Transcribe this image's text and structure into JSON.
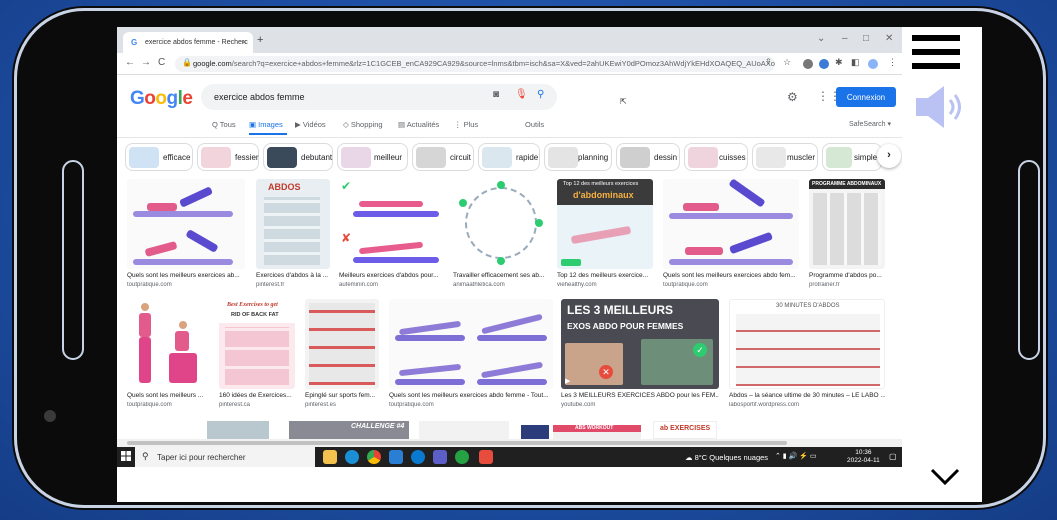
{
  "browser": {
    "tab_title": "exercice abdos femme - Recherc",
    "tab_close": "×",
    "new_tab": "+",
    "url_host": "google.com",
    "url_path": "/search?q=exercice+abdos+femme&rlz=1C1GCEB_enCA929CA929&source=lnms&tbm=isch&sa=X&ved=2ahUKEwiY0dPOmoz3AhWdjYkEHdXOAQEQ_AUoAXoECA...",
    "back": "←",
    "forward": "→",
    "reload": "C"
  },
  "google": {
    "logo": [
      "G",
      "o",
      "o",
      "g",
      "l",
      "e"
    ],
    "logo_colors": [
      "#4285f4",
      "#ea4335",
      "#fbbc05",
      "#4285f4",
      "#34a853",
      "#ea4335"
    ],
    "query": "exercice abdos femme",
    "sign_in": "Connexion",
    "tabs": [
      {
        "label": "Tous",
        "icon": "Q"
      },
      {
        "label": "Images",
        "icon": "▣"
      },
      {
        "label": "Vidéos",
        "icon": "▶"
      },
      {
        "label": "Shopping",
        "icon": "◇"
      },
      {
        "label": "Actualités",
        "icon": "▤"
      },
      {
        "label": "Plus",
        "icon": "⋮"
      }
    ],
    "outils": "Outils",
    "safesearch": "SafeSearch ▾"
  },
  "chips": [
    {
      "label": "efficace",
      "color": "#cfe3f5"
    },
    {
      "label": "fessier",
      "color": "#f2d4dc"
    },
    {
      "label": "debutant",
      "color": "#3a4a5a"
    },
    {
      "label": "meilleur",
      "color": "#e9d6e6"
    },
    {
      "label": "circuit",
      "color": "#d6d6d6"
    },
    {
      "label": "rapide",
      "color": "#dbe7ee"
    },
    {
      "label": "planning",
      "color": "#e4e4e4"
    },
    {
      "label": "dessin",
      "color": "#cfcfcf"
    },
    {
      "label": "cuisses",
      "color": "#f0d4dd"
    },
    {
      "label": "muscler",
      "color": "#e8e8e8"
    },
    {
      "label": "simple",
      "color": "#d4e8d4"
    }
  ],
  "results_row1": [
    {
      "caption": "Quels sont les meilleurs exercices ab...",
      "source": "toutpratique.com"
    },
    {
      "caption": "Exercices d'abdos à la ...",
      "source": "pinterest.fr",
      "overlay": "ABDOS"
    },
    {
      "caption": "Meilleurs exercices d'abdos pour...",
      "source": "aufeminin.com"
    },
    {
      "caption": "Travailler efficacement ses ab...",
      "source": "animaathletica.com"
    },
    {
      "caption": "Top 12 des meilleurs exercice...",
      "source": "viehealthy.com",
      "overlay_top": "Top 12 des meilleurs exercices",
      "overlay_main": "d'abdominaux"
    },
    {
      "caption": "Quels sont les meilleurs exercices abdo fem...",
      "source": "toutpratique.com"
    },
    {
      "caption": "Programme d'abdos po...",
      "source": "protrainer.fr",
      "overlay": "PROGRAMME ABDOMINAUX"
    }
  ],
  "results_row2": [
    {
      "caption": "Quels sont les meilleurs ...",
      "source": "toutpratique.com"
    },
    {
      "caption": "160 idées de Exercices...",
      "source": "pinterest.ca",
      "overlay_top": "Best Exercises to get",
      "overlay_main": "RID OF BACK FAT"
    },
    {
      "caption": "Épinglé sur sports fem...",
      "source": "pinterest.es"
    },
    {
      "caption": "Quels sont les meilleurs exercices abdo femme - Tout...",
      "source": "toutpratique.com"
    },
    {
      "caption": "Les 3 MEILLEURS EXERCICES ABDO pour les FEM...",
      "source": "youtube.com",
      "overlay_1": "LES 3 MEILLEURS",
      "overlay_2": "EXOS ABDO POUR FEMMES"
    },
    {
      "caption": "Abdos – la séance ultime de 30 minutes – LE LABO ...",
      "source": "labosportif.wordpress.com",
      "overlay": "30 MINUTES D'ABDOS"
    }
  ],
  "results_row3": {
    "challenge": "CHALLENGE #4",
    "abs_workout": "ABS WORKOUT",
    "exercises": "ab EXERCISES"
  },
  "taskbar": {
    "search_placeholder": "Taper ici pour rechercher",
    "weather": "8°C  Quelques nuages",
    "time": "10:36",
    "date": "2022-04-11"
  }
}
